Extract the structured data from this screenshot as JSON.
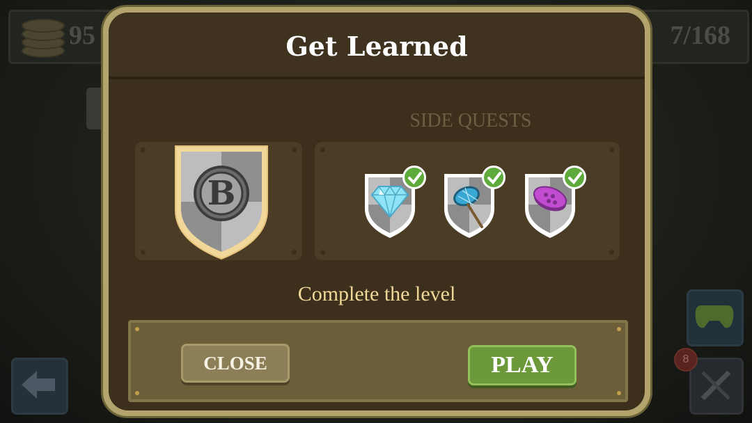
{
  "hud": {
    "coins_value": "95",
    "progress_value": "7/168",
    "notification_count": "8"
  },
  "dialog": {
    "title": "Get Learned",
    "badge_letter": "B",
    "side_quests_label": "SIDE QUESTS",
    "side_quests": [
      {
        "icon": "diamond-icon",
        "completed": true
      },
      {
        "icon": "bug-net-icon",
        "completed": true
      },
      {
        "icon": "purple-coin-icon",
        "completed": true
      }
    ],
    "objective": "Complete the level",
    "close_label": "CLOSE",
    "play_label": "PLAY"
  },
  "colors": {
    "dialog_border": "#b2a46c",
    "dialog_body": "#3c2f1c",
    "objective_text": "#f0d898",
    "play_button": "#6c9a3a",
    "close_button": "#8c7e56",
    "check_green": "#5eaa3a"
  }
}
